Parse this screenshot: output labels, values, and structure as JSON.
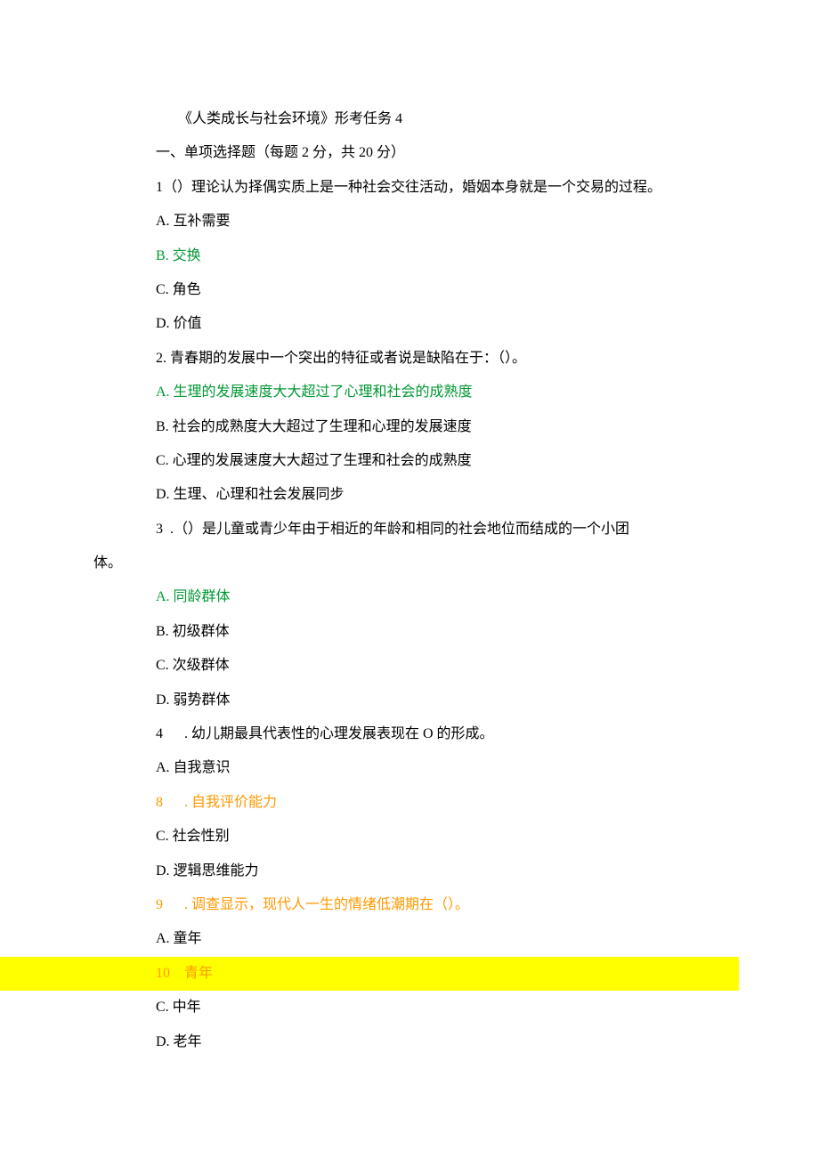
{
  "docTitle": "《人类成长与社会环境》形考任务 4",
  "sectionHeader": "一、单项选择题（每题 2 分，共 20 分）",
  "q1": {
    "stem": "1（）理论认为择偶实质上是一种社会交往活动，婚姻本身就是一个交易的过程。",
    "optA": "A. 互补需要",
    "optB": "B. 交换",
    "optC": "C. 角色",
    "optD": "D. 价值"
  },
  "q2": {
    "stem": "2. 青春期的发展中一个突出的特征或者说是缺陷在于：（）。",
    "optA": "A. 生理的发展速度大大超过了心理和社会的成熟度",
    "optB": "B. 社会的成熟度大大超过了生理和心理的发展速度",
    "optC": "C. 心理的发展速度大大超过了生理和社会的成熟度",
    "optD": "D. 生理、心理和社会发展同步"
  },
  "q3": {
    "stemLine1": "3  .（）是儿童或青少年由于相近的年龄和相同的社会地位而结成的一个小团",
    "stemLine2": "体。",
    "optA": "A. 同龄群体",
    "optB": "B. 初级群体",
    "optC": "C. 次级群体",
    "optD": "D. 弱势群体"
  },
  "q4": {
    "stem": "4      . 幼儿期最具代表性的心理发展表现在 O 的形成。",
    "optA": "A. 自我意识",
    "optB": "8      . 自我评价能力",
    "optC": "C. 社会性别",
    "optD": "D. 逻辑思维能力"
  },
  "q5": {
    "stem": "9      . 调查显示，现代人一生的情绪低潮期在（）。",
    "optA": "A. 童年",
    "optB": "10    青年",
    "optC": "C. 中年",
    "optD": "D. 老年"
  }
}
